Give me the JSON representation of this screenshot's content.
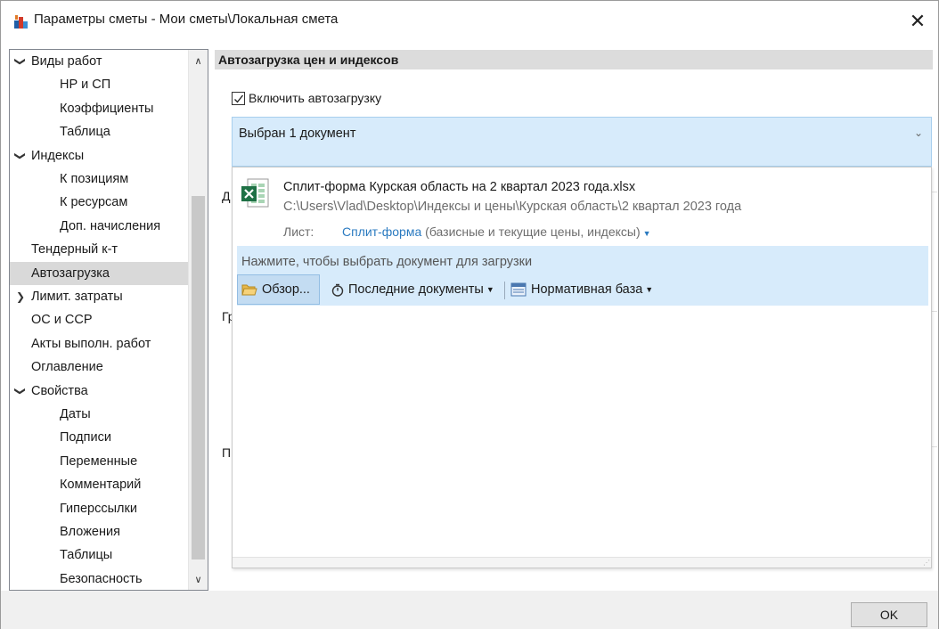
{
  "window": {
    "title": "Параметры сметы - Мои сметы\\Локальная смета",
    "close_glyph": "✕"
  },
  "tree": {
    "items": [
      {
        "label": "Виды работ",
        "level": 0,
        "toggle": "expanded",
        "selected": false
      },
      {
        "label": "НР и СП",
        "level": 1,
        "toggle": "none",
        "selected": false
      },
      {
        "label": "Коэффициенты",
        "level": 1,
        "toggle": "none",
        "selected": false
      },
      {
        "label": "Таблица",
        "level": 1,
        "toggle": "none",
        "selected": false
      },
      {
        "label": "Индексы",
        "level": 0,
        "toggle": "expanded",
        "selected": false
      },
      {
        "label": "К позициям",
        "level": 1,
        "toggle": "none",
        "selected": false
      },
      {
        "label": "К ресурсам",
        "level": 1,
        "toggle": "none",
        "selected": false
      },
      {
        "label": "Доп. начисления",
        "level": 1,
        "toggle": "none",
        "selected": false
      },
      {
        "label": "Тендерный к-т",
        "level": 0,
        "toggle": "none",
        "selected": false
      },
      {
        "label": "Автозагрузка",
        "level": 0,
        "toggle": "none",
        "selected": true
      },
      {
        "label": "Лимит. затраты",
        "level": 0,
        "toggle": "collapsed",
        "selected": false
      },
      {
        "label": "ОС и ССР",
        "level": 0,
        "toggle": "none",
        "selected": false
      },
      {
        "label": "Акты выполн. работ",
        "level": 0,
        "toggle": "none",
        "selected": false
      },
      {
        "label": "Оглавление",
        "level": 0,
        "toggle": "none",
        "selected": false
      },
      {
        "label": "Свойства",
        "level": 0,
        "toggle": "expanded",
        "selected": false
      },
      {
        "label": "Даты",
        "level": 1,
        "toggle": "none",
        "selected": false
      },
      {
        "label": "Подписи",
        "level": 1,
        "toggle": "none",
        "selected": false
      },
      {
        "label": "Переменные",
        "level": 1,
        "toggle": "none",
        "selected": false
      },
      {
        "label": "Комментарий",
        "level": 1,
        "toggle": "none",
        "selected": false
      },
      {
        "label": "Гиперссылки",
        "level": 1,
        "toggle": "none",
        "selected": false
      },
      {
        "label": "Вложения",
        "level": 1,
        "toggle": "none",
        "selected": false
      },
      {
        "label": "Таблицы",
        "level": 1,
        "toggle": "none",
        "selected": false
      },
      {
        "label": "Безопасность",
        "level": 1,
        "toggle": "none",
        "selected": false
      }
    ]
  },
  "panel": {
    "header": "Автозагрузка цен и индексов",
    "autoload_checkbox": {
      "label": "Включить автозагрузку",
      "checked": true
    },
    "combo_text": "Выбран 1 документ",
    "combo_arrow": "⌄",
    "ghost_labels": [
      "Д",
      "Гр",
      "П"
    ]
  },
  "dropdown": {
    "doc_name": "Сплит-форма Курская область на 2 квартал 2023 года.xlsx",
    "doc_path": "C:\\Users\\Vlad\\Desktop\\Индексы и цены\\Курская область\\2 квартал 2023 года",
    "sheet_label": "Лист:",
    "sheet_name": "Сплит-форма",
    "sheet_desc": "(базисные и текущие цены, индексы)",
    "pick_hint": "Нажмите, чтобы выбрать документ для загрузки",
    "browse_label": "Обзор...",
    "recent_label": "Последние документы",
    "norm_label": "Нормативная база"
  },
  "footer": {
    "ok_label": "OK"
  },
  "colors": {
    "selection_bg": "#d9d9d9",
    "accent_blue": "#d7ebfb",
    "link_blue": "#2a7ac0",
    "excel_green": "#1e7145"
  }
}
